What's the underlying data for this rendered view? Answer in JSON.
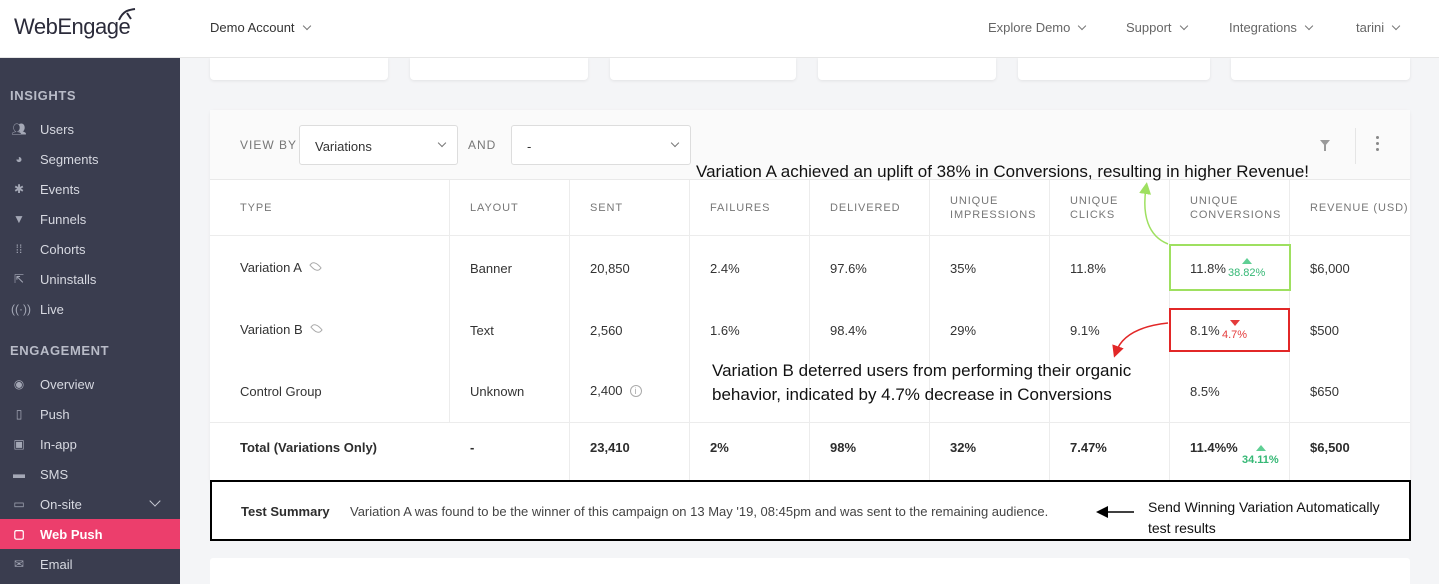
{
  "header": {
    "logo": "WebEngage",
    "account": "Demo Account",
    "nav": [
      "Explore Demo",
      "Support",
      "Integrations",
      "tarini"
    ]
  },
  "sidebar": {
    "sections": [
      {
        "title": "INSIGHTS",
        "items": [
          {
            "label": "Users",
            "icon": "users-icon"
          },
          {
            "label": "Segments",
            "icon": "pie-icon"
          },
          {
            "label": "Events",
            "icon": "star-icon"
          },
          {
            "label": "Funnels",
            "icon": "funnel-icon"
          },
          {
            "label": "Cohorts",
            "icon": "grid-icon"
          },
          {
            "label": "Uninstalls",
            "icon": "uninstall-icon"
          },
          {
            "label": "Live",
            "icon": "broadcast-icon"
          }
        ]
      },
      {
        "title": "ENGAGEMENT",
        "items": [
          {
            "label": "Overview",
            "icon": "eye-icon"
          },
          {
            "label": "Push",
            "icon": "phone-icon"
          },
          {
            "label": "In-app",
            "icon": "inapp-icon"
          },
          {
            "label": "SMS",
            "icon": "sms-icon"
          },
          {
            "label": "On-site",
            "icon": "onsite-icon"
          },
          {
            "label": "Web Push",
            "icon": "webpush-icon",
            "active": true
          },
          {
            "label": "Email",
            "icon": "mail-icon"
          }
        ]
      }
    ]
  },
  "filters": {
    "view_by_label": "VIEW BY",
    "view_by_value": "Variations",
    "and_label": "AND",
    "and_value": "-"
  },
  "table": {
    "columns": [
      "TYPE",
      "LAYOUT",
      "SENT",
      "FAILURES",
      "DELIVERED",
      "UNIQUE IMPRESSIONS",
      "UNIQUE CLICKS",
      "UNIQUE CONVERSIONS",
      "REVENUE (USD)"
    ],
    "rows": [
      {
        "type": "Variation A",
        "layout": "Banner",
        "sent": "20,850",
        "failures": "2.4%",
        "delivered": "97.6%",
        "impressions": "35%",
        "clicks": "11.8%",
        "conversions": "11.8%",
        "change": "38.82%",
        "change_dir": "up",
        "revenue": "$6,000"
      },
      {
        "type": "Variation B",
        "layout": "Text",
        "sent": "2,560",
        "failures": "1.6%",
        "delivered": "98.4%",
        "impressions": "29%",
        "clicks": "9.1%",
        "conversions": "8.1%",
        "change": "4.7%",
        "change_dir": "down",
        "revenue": "$500"
      },
      {
        "type": "Control Group",
        "layout": "Unknown",
        "sent": "2,400",
        "failures": "",
        "delivered": "",
        "impressions": "",
        "clicks": "",
        "conversions": "8.5%",
        "change": "",
        "change_dir": "",
        "revenue": "$650"
      }
    ],
    "total": {
      "type": "Total (Variations Only)",
      "layout": "-",
      "sent": "23,410",
      "failures": "2%",
      "delivered": "98%",
      "impressions": "32%",
      "clicks": "7.47%",
      "conversions": "11.4%%",
      "change": "34.11%",
      "revenue": "$6,500"
    }
  },
  "summary": {
    "label": "Test Summary",
    "text": "Variation A was found to be the winner of this campaign on 13 May '19, 08:45pm and was sent to the remaining audience."
  },
  "annotations": {
    "a": "Variation A achieved an uplift of 38% in Conversions, resulting in higher Revenue!",
    "b_line1": "Variation B deterred users from performing their organic",
    "b_line2": "behavior, indicated by 4.7% decrease in Conversions",
    "c_line1": "Send Winning Variation Automatically",
    "c_line2": "test results"
  },
  "colors": {
    "accent": "#ec3e6c",
    "sidebar": "#3a3d4f",
    "up": "#35b875",
    "down": "#e43b3b",
    "green_box": "#9ee060",
    "red_box": "#e22727"
  }
}
